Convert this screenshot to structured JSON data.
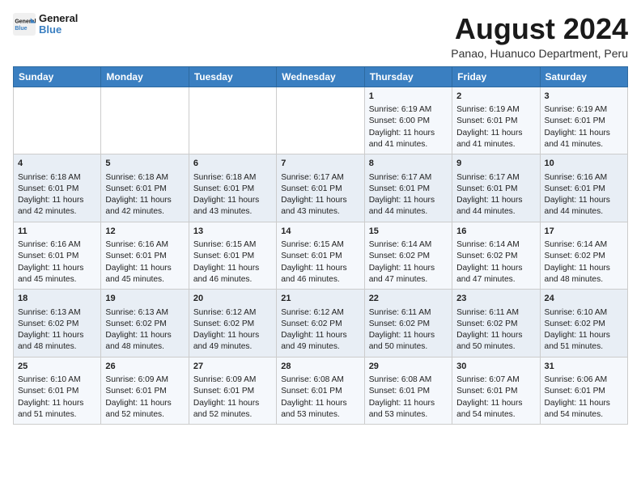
{
  "header": {
    "logo_line1": "General",
    "logo_line2": "Blue",
    "month_title": "August 2024",
    "location": "Panao, Huanuco Department, Peru"
  },
  "days_of_week": [
    "Sunday",
    "Monday",
    "Tuesday",
    "Wednesday",
    "Thursday",
    "Friday",
    "Saturday"
  ],
  "weeks": [
    [
      {
        "day": "",
        "content": ""
      },
      {
        "day": "",
        "content": ""
      },
      {
        "day": "",
        "content": ""
      },
      {
        "day": "",
        "content": ""
      },
      {
        "day": "1",
        "content": "Sunrise: 6:19 AM\nSunset: 6:00 PM\nDaylight: 11 hours\nand 41 minutes."
      },
      {
        "day": "2",
        "content": "Sunrise: 6:19 AM\nSunset: 6:01 PM\nDaylight: 11 hours\nand 41 minutes."
      },
      {
        "day": "3",
        "content": "Sunrise: 6:19 AM\nSunset: 6:01 PM\nDaylight: 11 hours\nand 41 minutes."
      }
    ],
    [
      {
        "day": "4",
        "content": "Sunrise: 6:18 AM\nSunset: 6:01 PM\nDaylight: 11 hours\nand 42 minutes."
      },
      {
        "day": "5",
        "content": "Sunrise: 6:18 AM\nSunset: 6:01 PM\nDaylight: 11 hours\nand 42 minutes."
      },
      {
        "day": "6",
        "content": "Sunrise: 6:18 AM\nSunset: 6:01 PM\nDaylight: 11 hours\nand 43 minutes."
      },
      {
        "day": "7",
        "content": "Sunrise: 6:17 AM\nSunset: 6:01 PM\nDaylight: 11 hours\nand 43 minutes."
      },
      {
        "day": "8",
        "content": "Sunrise: 6:17 AM\nSunset: 6:01 PM\nDaylight: 11 hours\nand 44 minutes."
      },
      {
        "day": "9",
        "content": "Sunrise: 6:17 AM\nSunset: 6:01 PM\nDaylight: 11 hours\nand 44 minutes."
      },
      {
        "day": "10",
        "content": "Sunrise: 6:16 AM\nSunset: 6:01 PM\nDaylight: 11 hours\nand 44 minutes."
      }
    ],
    [
      {
        "day": "11",
        "content": "Sunrise: 6:16 AM\nSunset: 6:01 PM\nDaylight: 11 hours\nand 45 minutes."
      },
      {
        "day": "12",
        "content": "Sunrise: 6:16 AM\nSunset: 6:01 PM\nDaylight: 11 hours\nand 45 minutes."
      },
      {
        "day": "13",
        "content": "Sunrise: 6:15 AM\nSunset: 6:01 PM\nDaylight: 11 hours\nand 46 minutes."
      },
      {
        "day": "14",
        "content": "Sunrise: 6:15 AM\nSunset: 6:01 PM\nDaylight: 11 hours\nand 46 minutes."
      },
      {
        "day": "15",
        "content": "Sunrise: 6:14 AM\nSunset: 6:02 PM\nDaylight: 11 hours\nand 47 minutes."
      },
      {
        "day": "16",
        "content": "Sunrise: 6:14 AM\nSunset: 6:02 PM\nDaylight: 11 hours\nand 47 minutes."
      },
      {
        "day": "17",
        "content": "Sunrise: 6:14 AM\nSunset: 6:02 PM\nDaylight: 11 hours\nand 48 minutes."
      }
    ],
    [
      {
        "day": "18",
        "content": "Sunrise: 6:13 AM\nSunset: 6:02 PM\nDaylight: 11 hours\nand 48 minutes."
      },
      {
        "day": "19",
        "content": "Sunrise: 6:13 AM\nSunset: 6:02 PM\nDaylight: 11 hours\nand 48 minutes."
      },
      {
        "day": "20",
        "content": "Sunrise: 6:12 AM\nSunset: 6:02 PM\nDaylight: 11 hours\nand 49 minutes."
      },
      {
        "day": "21",
        "content": "Sunrise: 6:12 AM\nSunset: 6:02 PM\nDaylight: 11 hours\nand 49 minutes."
      },
      {
        "day": "22",
        "content": "Sunrise: 6:11 AM\nSunset: 6:02 PM\nDaylight: 11 hours\nand 50 minutes."
      },
      {
        "day": "23",
        "content": "Sunrise: 6:11 AM\nSunset: 6:02 PM\nDaylight: 11 hours\nand 50 minutes."
      },
      {
        "day": "24",
        "content": "Sunrise: 6:10 AM\nSunset: 6:02 PM\nDaylight: 11 hours\nand 51 minutes."
      }
    ],
    [
      {
        "day": "25",
        "content": "Sunrise: 6:10 AM\nSunset: 6:01 PM\nDaylight: 11 hours\nand 51 minutes."
      },
      {
        "day": "26",
        "content": "Sunrise: 6:09 AM\nSunset: 6:01 PM\nDaylight: 11 hours\nand 52 minutes."
      },
      {
        "day": "27",
        "content": "Sunrise: 6:09 AM\nSunset: 6:01 PM\nDaylight: 11 hours\nand 52 minutes."
      },
      {
        "day": "28",
        "content": "Sunrise: 6:08 AM\nSunset: 6:01 PM\nDaylight: 11 hours\nand 53 minutes."
      },
      {
        "day": "29",
        "content": "Sunrise: 6:08 AM\nSunset: 6:01 PM\nDaylight: 11 hours\nand 53 minutes."
      },
      {
        "day": "30",
        "content": "Sunrise: 6:07 AM\nSunset: 6:01 PM\nDaylight: 11 hours\nand 54 minutes."
      },
      {
        "day": "31",
        "content": "Sunrise: 6:06 AM\nSunset: 6:01 PM\nDaylight: 11 hours\nand 54 minutes."
      }
    ]
  ]
}
